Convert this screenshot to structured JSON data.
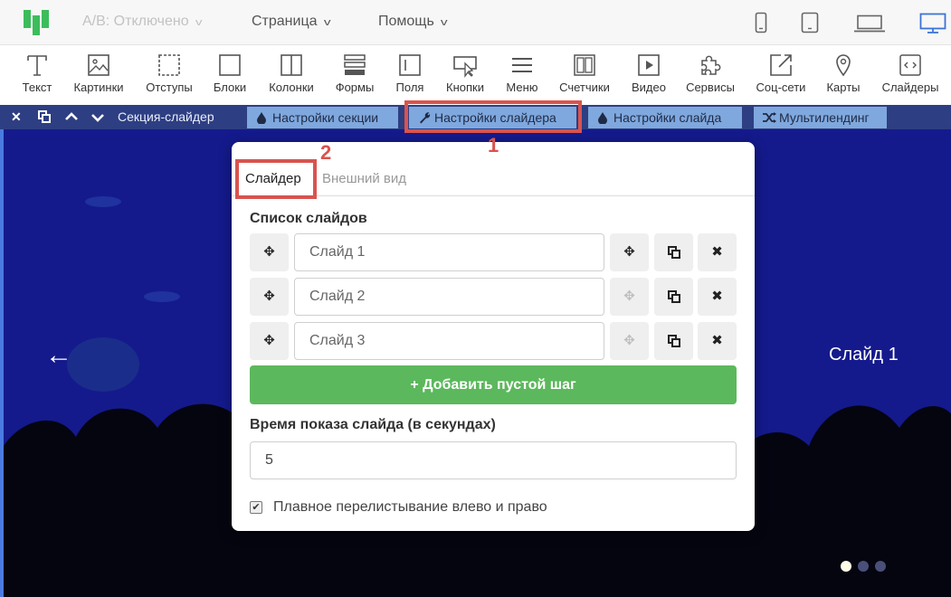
{
  "topbar": {
    "ab_label": "A/B: Отключено",
    "page_label": "Страница",
    "help_label": "Помощь"
  },
  "toolbar": {
    "items": [
      {
        "label": "Текст",
        "icon": "text-icon"
      },
      {
        "label": "Картинки",
        "icon": "image-icon"
      },
      {
        "label": "Отступы",
        "icon": "spacing-icon"
      },
      {
        "label": "Блоки",
        "icon": "block-icon"
      },
      {
        "label": "Колонки",
        "icon": "columns-icon"
      },
      {
        "label": "Формы",
        "icon": "forms-icon"
      },
      {
        "label": "Поля",
        "icon": "field-icon"
      },
      {
        "label": "Кнопки",
        "icon": "button-icon"
      },
      {
        "label": "Меню",
        "icon": "menu-icon"
      },
      {
        "label": "Счетчики",
        "icon": "counter-icon"
      },
      {
        "label": "Видео",
        "icon": "video-icon"
      },
      {
        "label": "Сервисы",
        "icon": "puzzle-icon"
      },
      {
        "label": "Соц-сети",
        "icon": "share-icon"
      },
      {
        "label": "Карты",
        "icon": "map-pin-icon"
      },
      {
        "label": "Слайдеры",
        "icon": "slider-icon"
      }
    ]
  },
  "section_bar": {
    "section_name": "Секция-слайдер",
    "section_settings": "Настройки секции",
    "slider_settings": "Настройки слайдера",
    "slide_settings": "Настройки слайда",
    "multilanding": "Мультилендинг"
  },
  "stage": {
    "slide_title": "Слайд 1",
    "arrow": "←"
  },
  "popup": {
    "tab_slider": "Слайдер",
    "tab_appearance": "Внешний вид",
    "slides_heading": "Список слайдов",
    "slides": [
      {
        "name": "Слайд 1"
      },
      {
        "name": "Слайд 2"
      },
      {
        "name": "Слайд 3"
      }
    ],
    "add_button": "Добавить пустой шаг",
    "duration_label": "Время показа слайда (в секундах)",
    "duration_value": "5",
    "smooth_label": "Плавное перелистывание влево и право"
  },
  "annotations": {
    "marker_1": "1",
    "marker_2": "2",
    "color": "#d9534f"
  },
  "colors": {
    "brand_green": "#3cbd5b",
    "section_bar": "#2e3e82",
    "stage_bg": "#141a8c",
    "add_green": "#5cb85c"
  }
}
